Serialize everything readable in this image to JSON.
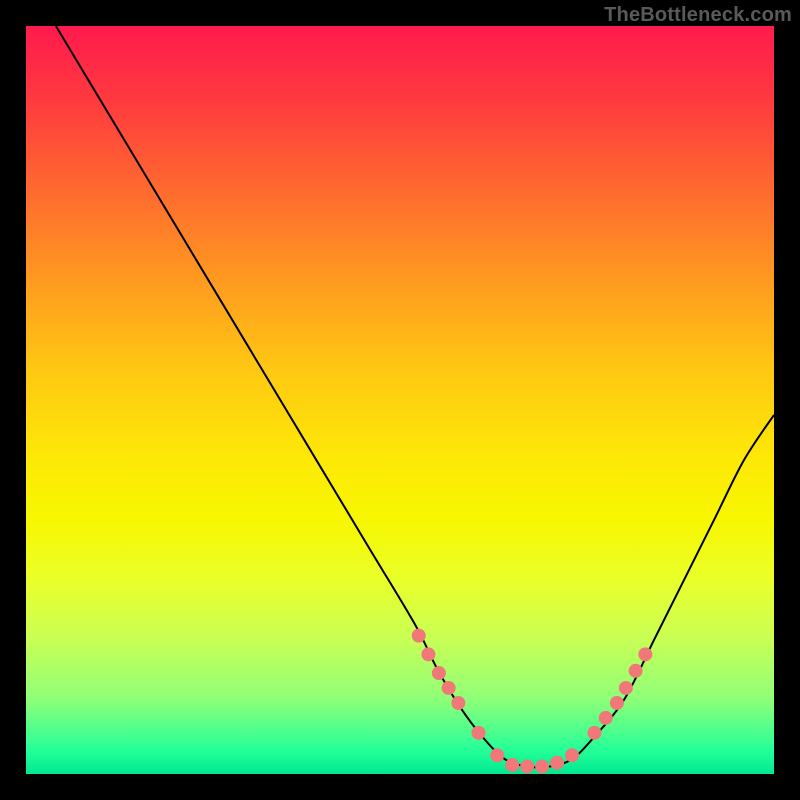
{
  "watermark": "TheBottleneck.com",
  "chart_data": {
    "type": "line",
    "title": "",
    "xlabel": "",
    "ylabel": "",
    "xlim": [
      0,
      100
    ],
    "ylim": [
      0,
      100
    ],
    "grid": false,
    "legend": false,
    "gradient_note": "background encodes bottleneck severity: red=high, green=low; curve shows bottleneck percentage vs component balance",
    "series": [
      {
        "name": "bottleneck-curve",
        "x": [
          4,
          10,
          16,
          22,
          28,
          34,
          40,
          46,
          52,
          55,
          58,
          61,
          64,
          67,
          70,
          73,
          76,
          80,
          84,
          88,
          92,
          96,
          100
        ],
        "y": [
          100,
          90,
          80,
          70,
          60,
          50,
          40,
          30,
          20,
          14,
          9,
          5,
          2,
          1,
          1,
          2,
          5,
          10,
          18,
          26,
          34,
          42,
          48
        ]
      },
      {
        "name": "marker-dots",
        "type": "scatter",
        "x": [
          52.5,
          53.8,
          55.2,
          56.5,
          57.8,
          60.5,
          63,
          65,
          67,
          69,
          71,
          73,
          76,
          77.5,
          79,
          80.2,
          81.5,
          82.8
        ],
        "y": [
          18.5,
          16,
          13.5,
          11.5,
          9.5,
          5.5,
          2.5,
          1.2,
          1,
          1,
          1.5,
          2.5,
          5.5,
          7.5,
          9.5,
          11.5,
          13.8,
          16
        ]
      }
    ]
  }
}
